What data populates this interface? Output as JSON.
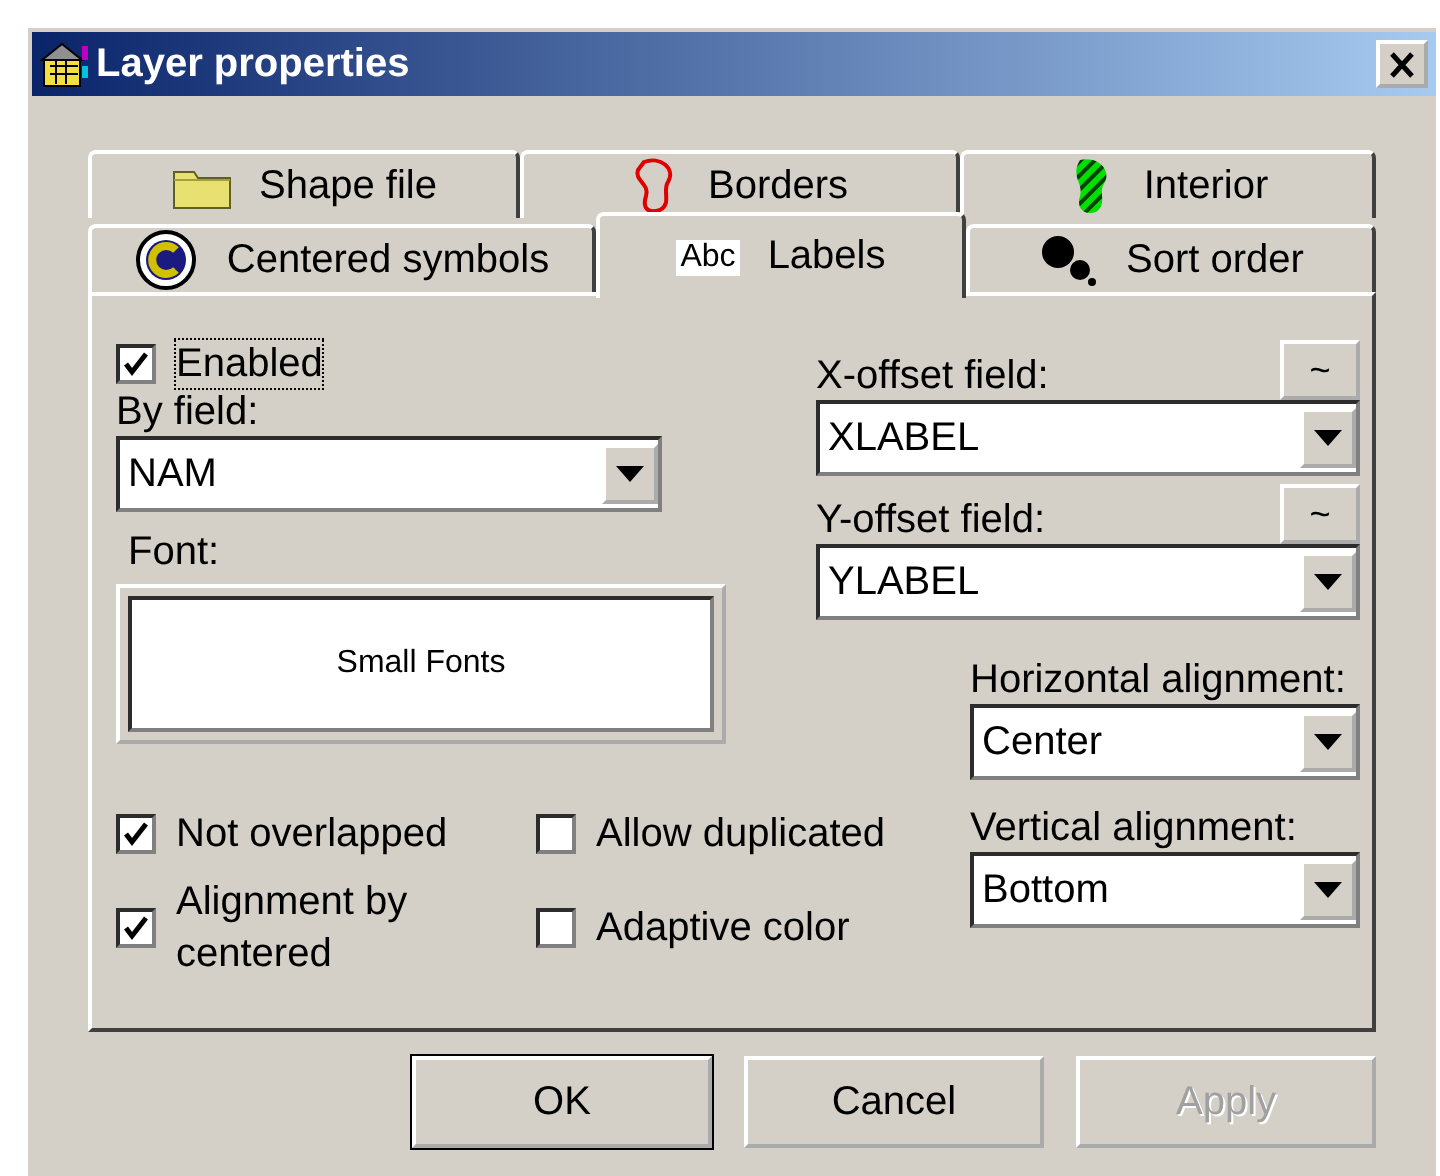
{
  "window": {
    "title": "Layer properties"
  },
  "tab_rows": [
    [
      {
        "label": "Shape file",
        "kind": "folder",
        "selected": false
      },
      {
        "label": "Borders",
        "kind": "outline",
        "selected": false
      },
      {
        "label": "Interior",
        "kind": "hatch",
        "selected": false
      }
    ],
    [
      {
        "label": "Centered symbols",
        "kind": "symbol",
        "selected": false
      },
      {
        "label": "Labels",
        "kind": "text",
        "icon_text": "Abc",
        "selected": true
      },
      {
        "label": "Sort order",
        "kind": "dots",
        "selected": false
      }
    ]
  ],
  "enabled": {
    "label": "Enabled",
    "checked": true
  },
  "by_field": {
    "label": "By field:",
    "value": "NAM"
  },
  "font": {
    "label": "Font:",
    "value": "Small Fonts"
  },
  "x_offset": {
    "label": "X-offset field:",
    "button": "~",
    "value": "XLABEL"
  },
  "y_offset": {
    "label": "Y-offset field:",
    "button": "~",
    "value": "YLABEL"
  },
  "horizontal_alignment": {
    "label": "Horizontal alignment:",
    "value": "Center"
  },
  "vertical_alignment": {
    "label": "Vertical alignment:",
    "value": "Bottom"
  },
  "options": [
    {
      "label": "Not overlapped",
      "checked": true
    },
    {
      "label": "Allow duplicated",
      "checked": false
    },
    {
      "label": "Alignment by centered",
      "checked": true
    },
    {
      "label": "Adaptive color",
      "checked": false
    }
  ],
  "buttons": [
    {
      "label": "OK",
      "default": true,
      "disabled": false
    },
    {
      "label": "Cancel",
      "default": false,
      "disabled": false
    },
    {
      "label": "Apply",
      "default": false,
      "disabled": true
    }
  ]
}
